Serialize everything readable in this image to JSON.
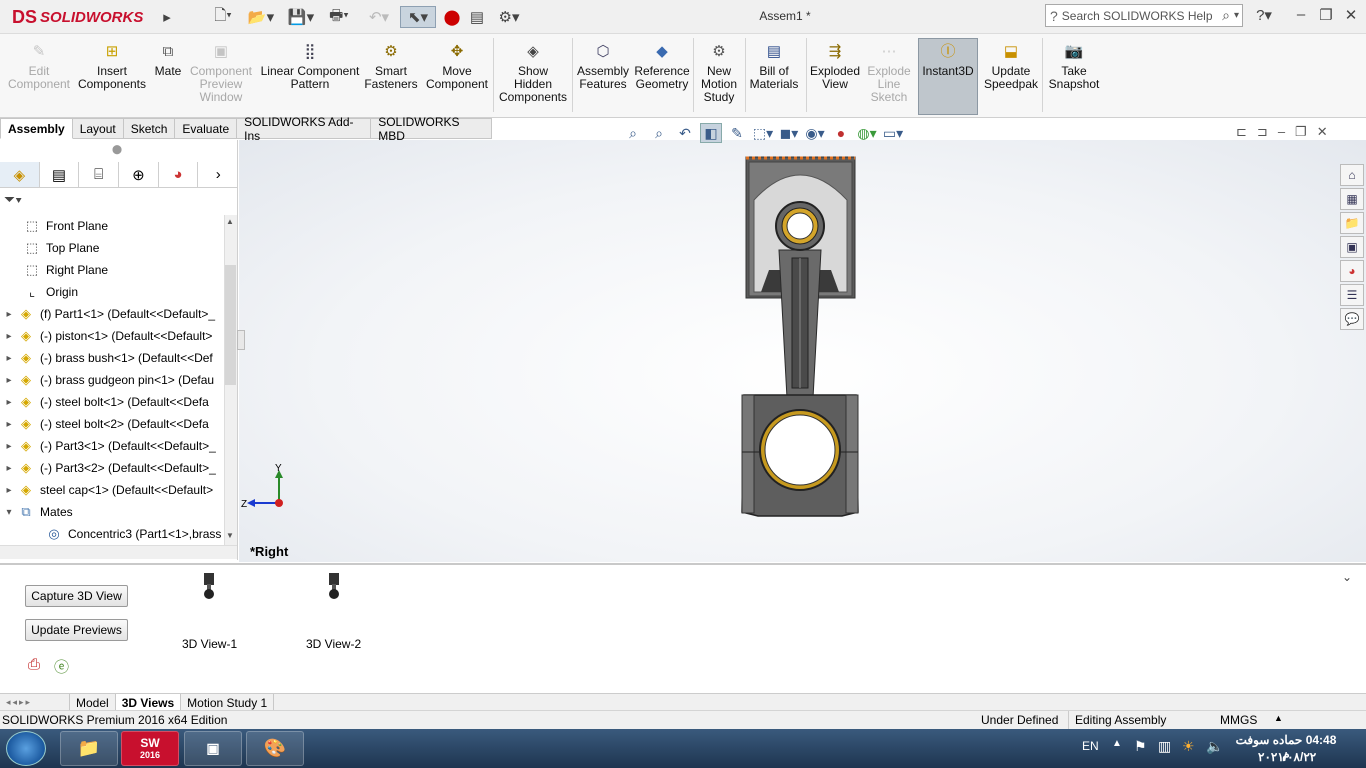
{
  "titlebar": {
    "brand": "SOLIDWORKS",
    "brand_mark": "DS",
    "doc_title": "Assem1 *",
    "search_placeholder": "Search SOLIDWORKS Help"
  },
  "ribbon": {
    "buttons": [
      {
        "label": "Edit\nComponent",
        "icon": "edit-component-icon",
        "enabled": false
      },
      {
        "label": "Insert\nComponents",
        "icon": "insert-components-icon",
        "enabled": true
      },
      {
        "label": "Mate",
        "icon": "mate-icon",
        "enabled": true
      },
      {
        "label": "Component\nPreview\nWindow",
        "icon": "preview-window-icon",
        "enabled": false
      },
      {
        "label": "Linear Component\nPattern",
        "icon": "linear-pattern-icon",
        "enabled": true
      },
      {
        "label": "Smart\nFasteners",
        "icon": "smart-fasteners-icon",
        "enabled": true
      },
      {
        "label": "Move\nComponent",
        "icon": "move-component-icon",
        "enabled": true
      },
      {
        "label": "Show\nHidden\nComponents",
        "icon": "show-hidden-icon",
        "enabled": true
      },
      {
        "label": "Assembly\nFeatures",
        "icon": "assembly-features-icon",
        "enabled": true
      },
      {
        "label": "Reference\nGeometry",
        "icon": "reference-geometry-icon",
        "enabled": true
      },
      {
        "label": "New\nMotion\nStudy",
        "icon": "motion-study-icon",
        "enabled": true
      },
      {
        "label": "Bill of\nMaterials",
        "icon": "bom-icon",
        "enabled": true
      },
      {
        "label": "Exploded\nView",
        "icon": "exploded-view-icon",
        "enabled": true
      },
      {
        "label": "Explode\nLine\nSketch",
        "icon": "explode-line-icon",
        "enabled": false
      },
      {
        "label": "Instant3D",
        "icon": "instant3d-icon",
        "enabled": true
      },
      {
        "label": "Update\nSpeedpak",
        "icon": "speedpak-icon",
        "enabled": true
      },
      {
        "label": "Take\nSnapshot",
        "icon": "camera-icon",
        "enabled": true
      }
    ]
  },
  "cm_tabs": [
    "Assembly",
    "Layout",
    "Sketch",
    "Evaluate",
    "SOLIDWORKS Add-Ins",
    "SOLIDWORKS MBD"
  ],
  "tree": {
    "items": [
      {
        "label": "Front Plane",
        "kind": "plane"
      },
      {
        "label": "Top Plane",
        "kind": "plane"
      },
      {
        "label": "Right Plane",
        "kind": "plane"
      },
      {
        "label": "Origin",
        "kind": "origin"
      },
      {
        "label": "(f) Part1<1> (Default<<Default>_",
        "kind": "comp"
      },
      {
        "label": "(-) piston<1> (Default<<Default>",
        "kind": "comp"
      },
      {
        "label": "(-) brass bush<1> (Default<<Def",
        "kind": "comp"
      },
      {
        "label": "(-) brass gudgeon pin<1> (Defau",
        "kind": "comp"
      },
      {
        "label": "(-) steel bolt<1> (Default<<Defa",
        "kind": "comp"
      },
      {
        "label": "(-) steel bolt<2> (Default<<Defa",
        "kind": "comp"
      },
      {
        "label": "(-) Part3<1> (Default<<Default>_",
        "kind": "comp"
      },
      {
        "label": "(-) Part3<2> (Default<<Default>_",
        "kind": "comp"
      },
      {
        "label": "steel cap<1> (Default<<Default>",
        "kind": "comp"
      },
      {
        "label": "Mates",
        "kind": "mates"
      },
      {
        "label": "Concentric3 (Part1<1>,brass",
        "kind": "mate"
      }
    ]
  },
  "viewport": {
    "view_name": "*Right",
    "triad": {
      "y": "Y",
      "z": "Z"
    }
  },
  "bottom_panel": {
    "capture_label": "Capture 3D View",
    "update_label": "Update Previews",
    "views": [
      "3D View-1",
      "3D View-2"
    ]
  },
  "bottom_tabs": [
    "Model",
    "3D Views",
    "Motion Study 1"
  ],
  "status": {
    "edition": "SOLIDWORKS Premium 2016 x64 Edition",
    "state": "Under Defined",
    "mode": "Editing Assembly",
    "units": "MMGS"
  },
  "taskbar": {
    "lang": "EN",
    "time": "04:48 حماده سوفت م",
    "date": "٢٠٢١/٠٨/٢٢",
    "sw_label": "2016"
  }
}
